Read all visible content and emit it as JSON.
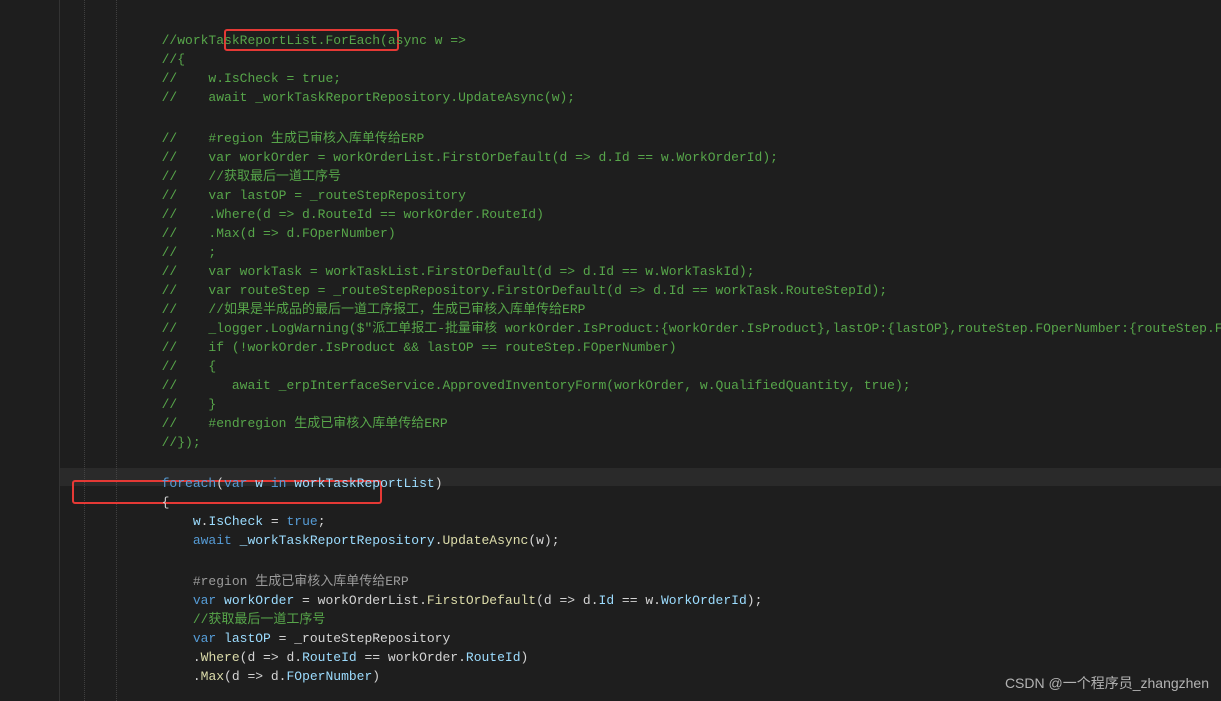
{
  "watermark": "CSDN @一个程序员_zhangzhen",
  "redbox1_label": "ForEach(async w =>",
  "redbox2_label": "foreach(var w in workTaskReportList)",
  "code_lines": [
    {
      "indent": 3,
      "tokens": [
        {
          "t": "//workTaskReportList.ForEach(async w =>",
          "c": "c-comment"
        }
      ]
    },
    {
      "indent": 3,
      "tokens": [
        {
          "t": "//{",
          "c": "c-comment"
        }
      ]
    },
    {
      "indent": 3,
      "tokens": [
        {
          "t": "//    w.IsCheck = true;",
          "c": "c-comment"
        }
      ]
    },
    {
      "indent": 3,
      "tokens": [
        {
          "t": "//    await _workTaskReportRepository.UpdateAsync(w);",
          "c": "c-comment"
        }
      ]
    },
    {
      "indent": 0,
      "tokens": []
    },
    {
      "indent": 3,
      "tokens": [
        {
          "t": "//    #region 生成已审核入库单传给ERP",
          "c": "c-comment"
        }
      ]
    },
    {
      "indent": 3,
      "tokens": [
        {
          "t": "//    var workOrder = workOrderList.FirstOrDefault(d => d.Id == w.WorkOrderId);",
          "c": "c-comment"
        }
      ]
    },
    {
      "indent": 3,
      "tokens": [
        {
          "t": "//    //获取最后一道工序号",
          "c": "c-comment"
        }
      ]
    },
    {
      "indent": 3,
      "tokens": [
        {
          "t": "//    var lastOP = _routeStepRepository",
          "c": "c-comment"
        }
      ]
    },
    {
      "indent": 3,
      "tokens": [
        {
          "t": "//    .Where(d => d.RouteId == workOrder.RouteId)",
          "c": "c-comment"
        }
      ]
    },
    {
      "indent": 3,
      "tokens": [
        {
          "t": "//    .Max(d => d.FOperNumber)",
          "c": "c-comment"
        }
      ]
    },
    {
      "indent": 3,
      "tokens": [
        {
          "t": "//    ;",
          "c": "c-comment"
        }
      ]
    },
    {
      "indent": 3,
      "tokens": [
        {
          "t": "//    var workTask = workTaskList.FirstOrDefault(d => d.Id == w.WorkTaskId);",
          "c": "c-comment"
        }
      ]
    },
    {
      "indent": 3,
      "tokens": [
        {
          "t": "//    var routeStep = _routeStepRepository.FirstOrDefault(d => d.Id == workTask.RouteStepId);",
          "c": "c-comment"
        }
      ]
    },
    {
      "indent": 3,
      "tokens": [
        {
          "t": "//    //如果是半成品的最后一道工序报工，生成已审核入库单传给ERP",
          "c": "c-comment"
        }
      ]
    },
    {
      "indent": 3,
      "tokens": [
        {
          "t": "//    _logger.LogWarning($\"派工单报工-批量审核 workOrder.IsProduct:{workOrder.IsProduct},lastOP:{lastOP},routeStep.FOperNumber:{routeStep.FOperNu",
          "c": "c-comment"
        }
      ]
    },
    {
      "indent": 3,
      "tokens": [
        {
          "t": "//    if (!workOrder.IsProduct && lastOP == routeStep.FOperNumber)",
          "c": "c-comment"
        }
      ]
    },
    {
      "indent": 3,
      "tokens": [
        {
          "t": "//    {",
          "c": "c-comment"
        }
      ]
    },
    {
      "indent": 3,
      "tokens": [
        {
          "t": "//       await _erpInterfaceService.ApprovedInventoryForm(workOrder, w.QualifiedQuantity, true);",
          "c": "c-comment"
        }
      ]
    },
    {
      "indent": 3,
      "tokens": [
        {
          "t": "//    }",
          "c": "c-comment"
        }
      ]
    },
    {
      "indent": 3,
      "tokens": [
        {
          "t": "//    #endregion 生成已审核入库单传给ERP",
          "c": "c-comment"
        }
      ]
    },
    {
      "indent": 3,
      "tokens": [
        {
          "t": "//});",
          "c": "c-comment"
        }
      ]
    },
    {
      "indent": 0,
      "tokens": []
    },
    {
      "indent": 3,
      "tokens": [
        {
          "t": "foreach",
          "c": "c-keyword"
        },
        {
          "t": "(",
          "c": "c-punct"
        },
        {
          "t": "var",
          "c": "c-keyword"
        },
        {
          "t": " w ",
          "c": "c-var"
        },
        {
          "t": "in",
          "c": "c-keyword"
        },
        {
          "t": " workTaskReportList",
          "c": "c-var"
        },
        {
          "t": ")",
          "c": "c-punct"
        }
      ]
    },
    {
      "indent": 3,
      "tokens": [
        {
          "t": "{",
          "c": "c-punct"
        }
      ]
    },
    {
      "indent": 4,
      "tokens": [
        {
          "t": "w",
          "c": "c-var"
        },
        {
          "t": ".",
          "c": "c-punct"
        },
        {
          "t": "IsCheck",
          "c": "c-var"
        },
        {
          "t": " = ",
          "c": "c-punct"
        },
        {
          "t": "true",
          "c": "c-keyword"
        },
        {
          "t": ";",
          "c": "c-punct"
        }
      ]
    },
    {
      "indent": 4,
      "tokens": [
        {
          "t": "await",
          "c": "c-keyword"
        },
        {
          "t": " _workTaskReportRepository",
          "c": "c-var"
        },
        {
          "t": ".",
          "c": "c-punct"
        },
        {
          "t": "UpdateAsync",
          "c": "c-method"
        },
        {
          "t": "(w);",
          "c": "c-punct"
        }
      ]
    },
    {
      "indent": 0,
      "tokens": []
    },
    {
      "indent": 4,
      "tokens": [
        {
          "t": "#region",
          "c": "c-region"
        },
        {
          "t": " 生成已审核入库单传给ERP",
          "c": "c-region"
        }
      ]
    },
    {
      "indent": 4,
      "tokens": [
        {
          "t": "var",
          "c": "c-keyword"
        },
        {
          "t": " workOrder",
          "c": "c-var"
        },
        {
          "t": " = workOrderList.",
          "c": "c-punct"
        },
        {
          "t": "FirstOrDefault",
          "c": "c-method"
        },
        {
          "t": "(d => d.",
          "c": "c-punct"
        },
        {
          "t": "Id",
          "c": "c-var"
        },
        {
          "t": " == w.",
          "c": "c-punct"
        },
        {
          "t": "WorkOrderId",
          "c": "c-var"
        },
        {
          "t": ");",
          "c": "c-punct"
        }
      ]
    },
    {
      "indent": 4,
      "tokens": [
        {
          "t": "//获取最后一道工序号",
          "c": "c-comment"
        }
      ]
    },
    {
      "indent": 4,
      "tokens": [
        {
          "t": "var",
          "c": "c-keyword"
        },
        {
          "t": " lastOP",
          "c": "c-var"
        },
        {
          "t": " = _routeStepRepository",
          "c": "c-punct"
        }
      ]
    },
    {
      "indent": 4,
      "tokens": [
        {
          "t": ".",
          "c": "c-punct"
        },
        {
          "t": "Where",
          "c": "c-method"
        },
        {
          "t": "(d => d.",
          "c": "c-punct"
        },
        {
          "t": "RouteId",
          "c": "c-var"
        },
        {
          "t": " == workOrder.",
          "c": "c-punct"
        },
        {
          "t": "RouteId",
          "c": "c-var"
        },
        {
          "t": ")",
          "c": "c-punct"
        }
      ]
    },
    {
      "indent": 4,
      "tokens": [
        {
          "t": ".",
          "c": "c-punct"
        },
        {
          "t": "Max",
          "c": "c-method"
        },
        {
          "t": "(d => d.",
          "c": "c-punct"
        },
        {
          "t": "FOperNumber",
          "c": "c-var"
        },
        {
          "t": ")",
          "c": "c-punct"
        }
      ]
    }
  ]
}
